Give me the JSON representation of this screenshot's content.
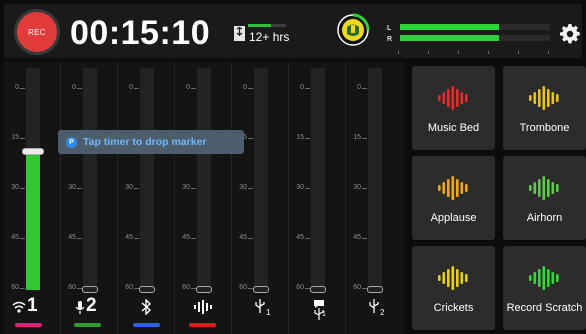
{
  "topbar": {
    "rec_label": "REC",
    "timer": "00:15:10",
    "storage_text": "12+ hrs",
    "storage_fraction": 0.6,
    "meter": {
      "left_label": "L",
      "right_label": "R",
      "left_level": 0.66,
      "right_level": 0.66
    },
    "settings_icon": "gear-icon",
    "logo_icon": "podcast-logo-icon"
  },
  "mixer": {
    "tooltip": "Tap timer to drop marker",
    "scale_labels": [
      "0",
      "15",
      "30",
      "45",
      "60"
    ],
    "channels": [
      {
        "number": "1",
        "sub": "",
        "icon": "wifi-mic-icon",
        "color": "#d4247a",
        "level": 0.62
      },
      {
        "number": "2",
        "sub": "",
        "icon": "mic-icon",
        "color": "#2f9e2f",
        "level": 0
      },
      {
        "number": "",
        "sub": "",
        "icon": "bluetooth-icon",
        "color": "#2a62e0",
        "level": 0
      },
      {
        "number": "",
        "sub": "",
        "icon": "soundpad-icon",
        "color": "#d62020",
        "level": 0
      },
      {
        "number": "",
        "sub": "1",
        "icon": "usb-icon",
        "color": "",
        "level": 0
      },
      {
        "number": "",
        "sub": "1",
        "icon": "usb-chat-icon",
        "color": "",
        "level": 0
      },
      {
        "number": "",
        "sub": "2",
        "icon": "usb-icon",
        "color": "",
        "level": 0
      }
    ]
  },
  "pads": [
    {
      "label": "Music Bed",
      "color": "#e82b2b"
    },
    {
      "label": "Trombone",
      "color": "#e8c21e"
    },
    {
      "label": "Applause",
      "color": "#f0a81c"
    },
    {
      "label": "Airhorn",
      "color": "#5ec94a"
    },
    {
      "label": "Crickets",
      "color": "#e6d21c"
    },
    {
      "label": "Record Scratch",
      "color": "#33d838"
    }
  ]
}
